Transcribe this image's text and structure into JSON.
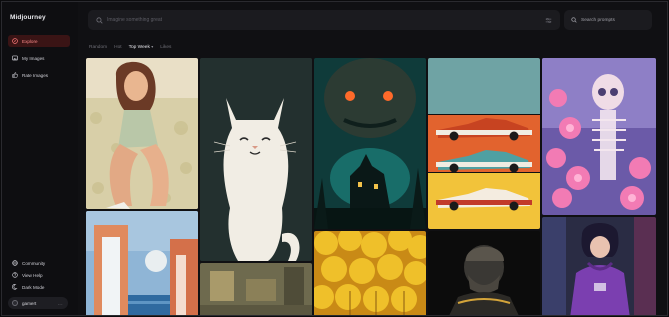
{
  "app": {
    "title": "Midjourney"
  },
  "sidebar": {
    "items": [
      {
        "label": "Explore",
        "active": true,
        "icon": "compass-icon"
      },
      {
        "label": "My Images",
        "active": false,
        "icon": "images-icon"
      },
      {
        "label": "Rate Images",
        "active": false,
        "icon": "thumbs-up-icon"
      }
    ],
    "bottom": [
      {
        "label": "Community",
        "icon": "globe-icon"
      },
      {
        "label": "View Help",
        "icon": "help-icon"
      },
      {
        "label": "Dark Mode",
        "icon": "moon-icon"
      }
    ],
    "user": {
      "name": "gamert",
      "more": "..."
    }
  },
  "search": {
    "placeholder": "Imagine something great",
    "side_placeholder": "Search prompts"
  },
  "filters": {
    "items": [
      "Random",
      "Hot",
      "Top Week",
      "Likes"
    ],
    "active": "Top Week"
  },
  "colors": {
    "accent": "#ff5a5a",
    "active_bg": "#3a1415",
    "background": "#101013"
  }
}
